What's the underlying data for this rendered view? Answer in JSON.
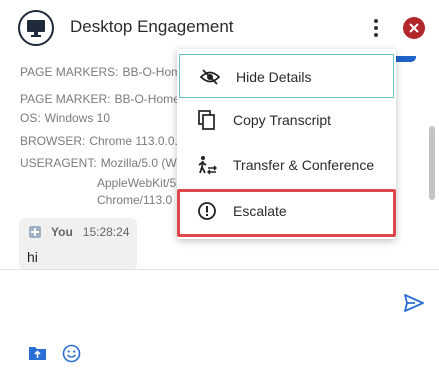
{
  "header": {
    "title": "Desktop Engagement",
    "accent_color": "#1e64c8",
    "close_color": "#b3262a"
  },
  "details": [
    {
      "key": "PAGE MARKERS:",
      "value": "BB-O-Home"
    },
    {
      "key": "PAGE MARKER:",
      "value": "BB-O-Homep"
    },
    {
      "key": "OS:",
      "value": "Windows 10"
    },
    {
      "key": "BROWSER:",
      "value": "Chrome 113.0.0.0"
    },
    {
      "key": "USERAGENT:",
      "value": "Mozilla/5.0 (W"
    },
    {
      "key": "",
      "value": "AppleWebKit/5"
    },
    {
      "key": "",
      "value": "Chrome/113.0"
    }
  ],
  "message": {
    "sender": "You",
    "time": "15:28:24",
    "text": "hi"
  },
  "menu": {
    "items": [
      {
        "label": "Hide Details",
        "icon": "eye-off-icon"
      },
      {
        "label": "Copy Transcript",
        "icon": "copy-icon"
      },
      {
        "label": "Transfer & Conference",
        "icon": "transfer-icon"
      },
      {
        "label": "Escalate",
        "icon": "alert-circle-icon"
      }
    ],
    "highlight_color": "#e0474c"
  },
  "composer": {
    "send_icon": "send-icon",
    "attach_icon": "upload-folder-icon",
    "emoji_icon": "emoji-icon"
  }
}
